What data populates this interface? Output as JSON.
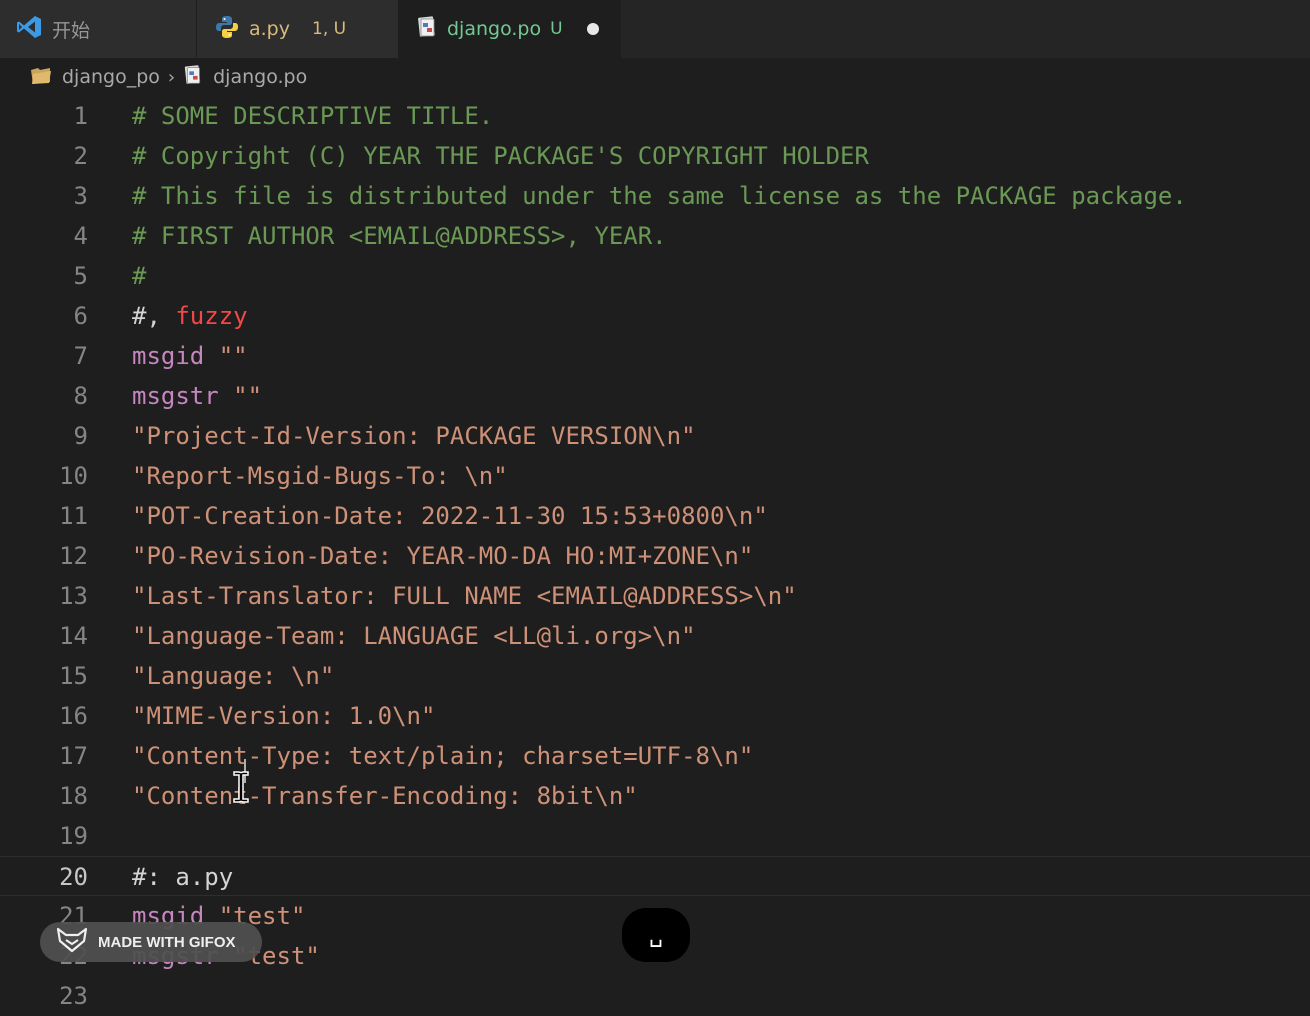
{
  "tabs": [
    {
      "label": "开始",
      "icon": "vscode-logo-icon"
    },
    {
      "label": "a.py",
      "decoration": "1, U",
      "icon": "python-icon"
    },
    {
      "label": "django.po",
      "decoration": "U",
      "icon": "po-file-icon",
      "active": true,
      "dirty": true
    }
  ],
  "breadcrumb": {
    "folder": "django_po",
    "file": "django.po"
  },
  "editor": {
    "lines": [
      {
        "n": "1",
        "parts": [
          {
            "t": "# SOME DESCRIPTIVE TITLE.",
            "c": "comment"
          }
        ]
      },
      {
        "n": "2",
        "parts": [
          {
            "t": "# Copyright (C) YEAR THE PACKAGE'S COPYRIGHT HOLDER",
            "c": "comment"
          }
        ]
      },
      {
        "n": "3",
        "parts": [
          {
            "t": "# This file is distributed under the same license as the PACKAGE package.",
            "c": "comment"
          }
        ]
      },
      {
        "n": "4",
        "parts": [
          {
            "t": "# FIRST AUTHOR <EMAIL@ADDRESS>, YEAR.",
            "c": "comment"
          }
        ]
      },
      {
        "n": "5",
        "parts": [
          {
            "t": "#",
            "c": "comment"
          }
        ]
      },
      {
        "n": "6",
        "parts": [
          {
            "t": "#, ",
            "c": "plain"
          },
          {
            "t": "fuzzy",
            "c": "fuzzy"
          }
        ]
      },
      {
        "n": "7",
        "parts": [
          {
            "t": "msgid",
            "c": "kw"
          },
          {
            "t": " ",
            "c": "plain"
          },
          {
            "t": "\"\"",
            "c": "str"
          }
        ]
      },
      {
        "n": "8",
        "parts": [
          {
            "t": "msgstr",
            "c": "kw"
          },
          {
            "t": " ",
            "c": "plain"
          },
          {
            "t": "\"\"",
            "c": "str"
          }
        ]
      },
      {
        "n": "9",
        "parts": [
          {
            "t": "\"Project-Id-Version: PACKAGE VERSION\\n\"",
            "c": "str"
          }
        ]
      },
      {
        "n": "10",
        "parts": [
          {
            "t": "\"Report-Msgid-Bugs-To: \\n\"",
            "c": "str"
          }
        ]
      },
      {
        "n": "11",
        "parts": [
          {
            "t": "\"POT-Creation-Date: 2022-11-30 15:53+0800\\n\"",
            "c": "str"
          }
        ]
      },
      {
        "n": "12",
        "parts": [
          {
            "t": "\"PO-Revision-Date: YEAR-MO-DA HO:MI+ZONE\\n\"",
            "c": "str"
          }
        ]
      },
      {
        "n": "13",
        "parts": [
          {
            "t": "\"Last-Translator: FULL NAME <EMAIL@ADDRESS>\\n\"",
            "c": "str"
          }
        ]
      },
      {
        "n": "14",
        "parts": [
          {
            "t": "\"Language-Team: LANGUAGE <LL@li.org>\\n\"",
            "c": "str"
          }
        ]
      },
      {
        "n": "15",
        "parts": [
          {
            "t": "\"Language: \\n\"",
            "c": "str"
          }
        ]
      },
      {
        "n": "16",
        "parts": [
          {
            "t": "\"MIME-Version: 1.0\\n\"",
            "c": "str"
          }
        ]
      },
      {
        "n": "17",
        "parts": [
          {
            "t": "\"Content-Type: text/plain; charset=UTF-8\\n\"",
            "c": "str"
          }
        ]
      },
      {
        "n": "18",
        "parts": [
          {
            "t": "\"Content-Transfer-Encoding: 8bit\\n\"",
            "c": "str"
          }
        ]
      },
      {
        "n": "19",
        "parts": []
      },
      {
        "n": "20",
        "parts": [
          {
            "t": "#: a.py",
            "c": "plain"
          }
        ],
        "current": true
      },
      {
        "n": "21",
        "parts": [
          {
            "t": "msgid",
            "c": "kw"
          },
          {
            "t": " ",
            "c": "plain"
          },
          {
            "t": "\"test\"",
            "c": "str"
          }
        ]
      },
      {
        "n": "22",
        "parts": [
          {
            "t": "msgstr",
            "c": "kw"
          },
          {
            "t": " ",
            "c": "plain"
          },
          {
            "t": "\"test\"",
            "c": "str"
          }
        ]
      },
      {
        "n": "23",
        "parts": []
      }
    ]
  },
  "overlays": {
    "gifox_badge": "MADE WITH GIFOX",
    "key_pressed": "␣"
  },
  "colors": {
    "comment": "#6a9955",
    "keyword": "#c586c0",
    "string": "#ce9178",
    "fuzzy": "#f44747",
    "untracked": "#73c991",
    "modified": "#d7ba7d"
  }
}
